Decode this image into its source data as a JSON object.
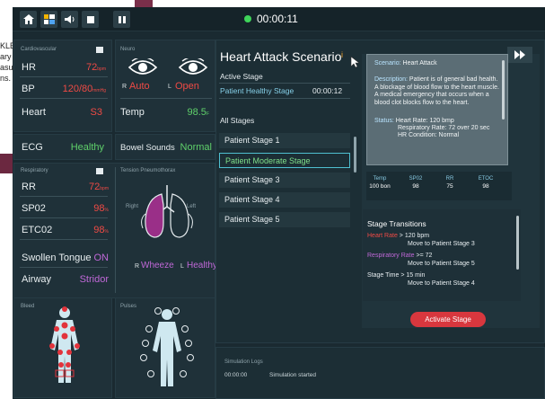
{
  "background_doc": {
    "lines": [
      "KLE",
      "ary",
      "asu",
      "ns."
    ]
  },
  "topbar": {
    "timer": "00:00:11",
    "buttons": [
      "home-icon",
      "layout-icon",
      "volume-icon",
      "stop-icon",
      "pause-icon"
    ],
    "forward_icon": "fast-forward-icon"
  },
  "cardiovascular": {
    "title": "Cardiovascular",
    "hr": {
      "label": "HR",
      "value": "72",
      "unit": "bpm"
    },
    "bp": {
      "label": "BP",
      "value": "120/80",
      "unit": "mmHg"
    },
    "heart": {
      "label": "Heart",
      "value": "S3"
    }
  },
  "neuro": {
    "title": "Neuro",
    "right": {
      "side": "R",
      "value": "Auto"
    },
    "left": {
      "side": "L",
      "value": "Open"
    },
    "temp": {
      "label": "Temp",
      "value": "98.5",
      "unit": "F"
    }
  },
  "ecg": {
    "label": "ECG",
    "value": "Healthy"
  },
  "bowel": {
    "label": "Bowel Sounds",
    "value": "Normal"
  },
  "respiratory": {
    "title": "Respiratory",
    "rr": {
      "label": "RR",
      "value": "72",
      "unit": "bpm"
    },
    "spo2": {
      "label": "SP02",
      "value": "98",
      "unit": "%"
    },
    "etco2": {
      "label": "ETC02",
      "value": "98",
      "unit": "%"
    },
    "tongue": {
      "label": "Swollen Tongue",
      "value": "ON"
    },
    "airway": {
      "label": "Airway",
      "value": "Stridor"
    }
  },
  "tension": {
    "title": "Tension Pneumothorax",
    "right_label": "Right",
    "left_label": "Left",
    "r": {
      "side": "R",
      "value": "Wheeze"
    },
    "l": {
      "side": "L",
      "value": "Healthy"
    }
  },
  "bleed": {
    "title": "Bleed"
  },
  "pulses": {
    "title": "Pulses"
  },
  "scenario": {
    "title": "Heart Attack Scenario",
    "info_icon": "i",
    "active_stage_label": "Active Stage",
    "active_stage_name": "Patient Healthy Stage",
    "active_stage_time": "00:00:12",
    "all_stages_label": "All Stages",
    "stages": [
      "Patient Stage 1",
      "Patient Moderate Stage",
      "Patient Stage 3",
      "Patient Stage 4",
      "Patient Stage 5"
    ]
  },
  "tooltip": {
    "scenario_label": "Scenario:",
    "scenario_value": "Heart Attack",
    "description_label": "Description:",
    "description_value": "Patient is of general bad health. A blockage of blood flow to the heart muscle. A medical emergency that occurs when a blood clot blocks flow to the heart.",
    "status_label": "Status:",
    "status_lines": [
      "Heart Rate: 120 bmp",
      "Respiratory Rate: 72 over 20 sec",
      "HR Condition: Normal"
    ]
  },
  "mini_vitals": [
    {
      "label": "Temp",
      "value": "100 bon"
    },
    {
      "label": "SP02",
      "value": "98"
    },
    {
      "label": "RR",
      "value": "75"
    },
    {
      "label": "ETOC",
      "value": "98"
    }
  ],
  "transitions": {
    "title": "Stage Transitions",
    "items": [
      {
        "cond_label": "Heart Rate",
        "cond_rest": " > 120 bpm",
        "target": "Move to Patient Stage 3"
      },
      {
        "cond_label": "Respiratory Rate",
        "cond_rest": " >= 72",
        "target": "Move to Patient Stage 5"
      },
      {
        "cond_label": "Stage Time",
        "cond_rest": " > 15 min",
        "target": "Move to Patient Stage 4"
      }
    ],
    "activate_button": "Activate Stage"
  },
  "logs": {
    "title": "Simulation Logs",
    "entries": [
      {
        "time": "00:00:00",
        "message": "Simulation started"
      }
    ]
  },
  "colors": {
    "accent_green": "#5fd06a",
    "alert_red": "#ef4a45",
    "purple": "#c068d8",
    "button_red": "#d8373e",
    "panel_bg": "#1f3139"
  }
}
